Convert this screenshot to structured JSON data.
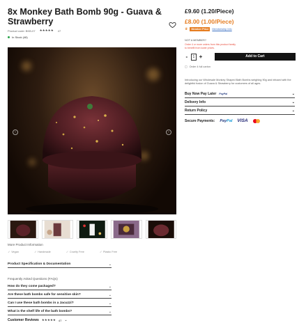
{
  "product": {
    "title": "8x Monkey Bath Bomb 90g - Guava & Strawberry",
    "code": "Product code: BKB-07",
    "rating_stars": "★★★★★",
    "rating_count": "47",
    "stock": "In Stock (48)"
  },
  "pricing": {
    "price": "£9.60 (1.20/Piece)",
    "member_price": "£8.00 (1.00/Piece)",
    "member_badge": "Member Price",
    "member_link": "Membership Info",
    "not_member": "NOT A MEMBER?",
    "not_member_note": "Order 4 or more orders from this product family to benefit from lower prices."
  },
  "cart": {
    "minus": "-",
    "quantity": "1",
    "plus": "+",
    "add_label": "Add to Cart",
    "order_note": "Order 4 full carton"
  },
  "description": "Introducing our Wholesale Monkey Shaped Bath Bombs weighing 90g and infused with the delightful fusion of Guava & Strawberry for customers of all ages.",
  "right_accordions": [
    {
      "label": "Buy Now Pay Later",
      "extra": "PayPal"
    },
    {
      "label": "Delivery Info",
      "extra": ""
    },
    {
      "label": "Return Policy",
      "extra": ""
    }
  ],
  "secure": {
    "label": "Secure Payments:",
    "paypal_a": "Pay",
    "paypal_b": "Pal",
    "visa": "VISA"
  },
  "more_info": "More Product Information",
  "badges": [
    "Vegan",
    "Handmade",
    "Cruelty Free",
    "Plastic Free"
  ],
  "spec_label": "Product Specification & Documentation",
  "faq_head": "Frequently Asked Questions (FAQs)",
  "faqs": [
    "How do they come packaged?",
    "Are these bath bombs safe for sensitive skin?",
    "Can I use these bath bombs in a Jacuzzi?",
    "What is the shelf life of the bath bombs?"
  ],
  "reviews": {
    "label": "Customer Reviews",
    "stars": "★★★★★",
    "count": "47"
  },
  "colors": {
    "accent": "#e67e22",
    "button": "#141414",
    "in_stock": "#2aa44a"
  }
}
